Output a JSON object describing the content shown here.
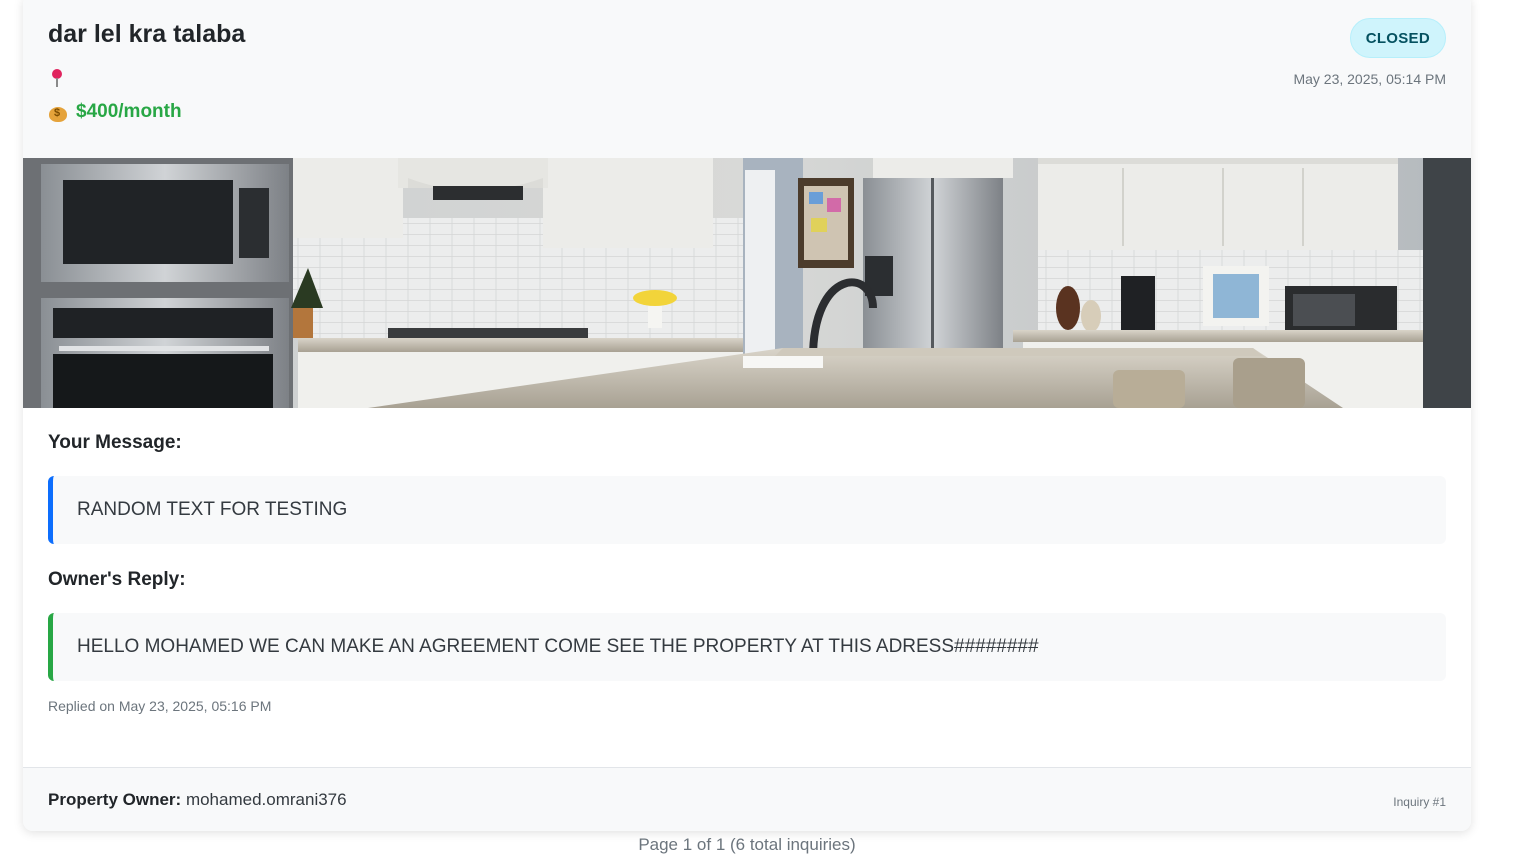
{
  "listing": {
    "title": "dar lel kra talaba",
    "status": "CLOSED",
    "date": "May 23, 2025, 05:14 PM",
    "location": "",
    "price": "$400/month"
  },
  "message": {
    "label": "Your Message:",
    "text": "RANDOM TEXT FOR TESTING"
  },
  "reply": {
    "label": "Owner's Reply:",
    "text": "HELLO MOHAMED WE CAN MAKE AN AGREEMENT COME SEE THE PROPERTY AT THIS ADRESS########",
    "replied_on": "Replied on May 23, 2025, 05:16 PM"
  },
  "footer": {
    "owner_label": "Property Owner:",
    "owner_name": "mohamed.omrani376",
    "inquiry_number": "Inquiry #1"
  },
  "pagination": {
    "info": "Page 1 of 1 (6 total inquiries)"
  },
  "icons": {
    "location": "map-pin-icon",
    "price": "money-bag-icon"
  },
  "colors": {
    "status_badge_bg": "#cff4fc",
    "status_badge_text": "#055160",
    "price": "#28a745",
    "message_border": "#0d6efd",
    "reply_border": "#28a745"
  }
}
